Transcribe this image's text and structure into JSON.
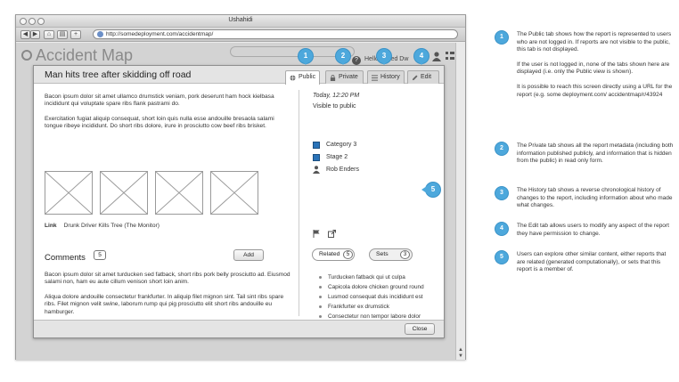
{
  "browser": {
    "window_title": "Ushahidi",
    "url": "http://somedeployment.com/accidentmap/",
    "toolbar_buttons": [
      "◀",
      "▶",
      "⌂",
      "▤",
      "+"
    ]
  },
  "background_page": {
    "title": "Accident Map",
    "header_right": "Hello, Jared Dw"
  },
  "report": {
    "title": "Man hits tree after skidding off road",
    "tabs": [
      {
        "label": "Public",
        "icon": "globe-icon"
      },
      {
        "label": "Private",
        "icon": "lock-icon"
      },
      {
        "label": "History",
        "icon": "list-icon"
      },
      {
        "label": "Edit",
        "icon": "pencil-icon"
      }
    ],
    "paragraphs": [
      "Bacon ipsum dolor sit amet ullamco drumstick veniam, pork deserunt ham hock kielbasa incididunt qui voluptate spare ribs flank pastrami do.",
      "Exercitation fugiat aliquip consequat, short loin quis nulla esse andouille bresaola salami tongue ribeye incididunt. Do short ribs dolore, irure in prosciutto cow beef ribs brisket."
    ],
    "link": {
      "label": "Link",
      "text": "Drunk Driver Kills Tree (The Monitor)"
    },
    "comments": {
      "heading": "Comments",
      "count": "5",
      "add_label": "Add",
      "items": [
        "Bacon ipsum dolor sit amet turducken sed fatback, short ribs pork belly prosciutto ad. Eiusmod salami non, ham eu aute cillum venison short loin anim.",
        "Aliqua dolore andouille consectetur frankfurter. In aliquip filet mignon sint. Tail sint ribs spare ribs. Filet mignon velit swine, laborum rump qui pig prosciutto elit short ribs andouille eu hamburger."
      ]
    },
    "sidebar": {
      "date": "Today, 12:20 PM",
      "visibility": "Visible to public",
      "categories": [
        "Category 3",
        "Stage 2"
      ],
      "author": "Rob Enders",
      "related_label": "Related",
      "related_count": "5",
      "sets_label": "Sets",
      "sets_count": "3",
      "related_items": [
        "Turducken fatback qui ut culpa",
        "Capicola dolore chicken ground round",
        "Lusmod consequat duis incididunt est",
        "Frankfurter ex drumstick",
        "Consectetur non tempor labore dolor"
      ]
    },
    "close_label": "Close"
  },
  "markers": [
    "1",
    "2",
    "3",
    "4",
    "5"
  ],
  "annotations": [
    {
      "number": "1",
      "paragraphs": [
        "The Public tab shows how the report is represented to users who are not logged in. If reports are not visible to the public, this tab is not displayed.",
        "If the user is not logged in, none of the tabs shown here are displayed (i.e. only the Public view is shown).",
        "It is possible to reach this screen directly using a URL for the report (e.g. some deployment.com/ accidentmap/r/43924"
      ]
    },
    {
      "number": "2",
      "paragraphs": [
        "The Private tab shows all the report metadata (including both information published publicly, and information that is hidden from the public) in read only form."
      ]
    },
    {
      "number": "3",
      "paragraphs": [
        "The History tab shows a reverse chronological history of changes to the report, including information about who made what changes."
      ]
    },
    {
      "number": "4",
      "paragraphs": [
        "The Edit tab allows users to modify any aspect of the report they have permission to change."
      ]
    },
    {
      "number": "5",
      "paragraphs": [
        "Users can explore other similar content, either reports that are related (generated computationally), or sets that this report is a member of."
      ]
    }
  ],
  "colors": {
    "accent": "#4da8dc",
    "category": "#2a73b8"
  }
}
